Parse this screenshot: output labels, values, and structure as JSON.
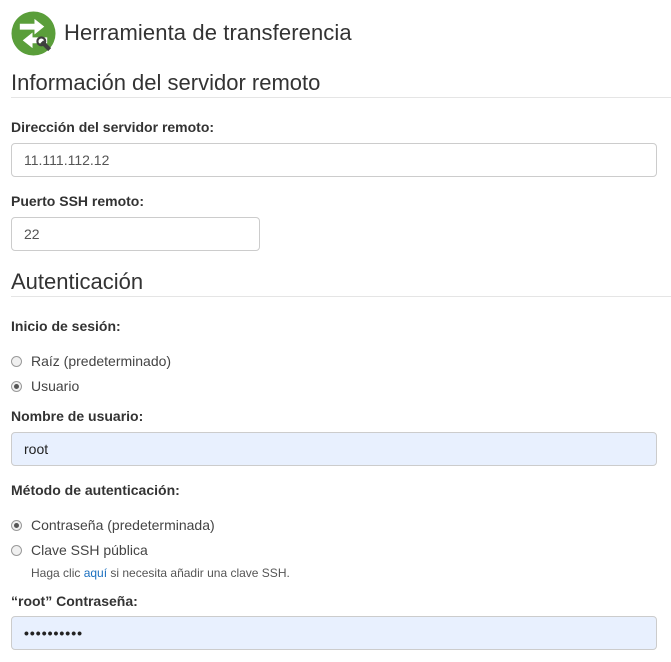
{
  "header": {
    "title": "Herramienta de transferencia",
    "logo_icon": "transfer-tool-icon",
    "logo_color": "#5a9e3a"
  },
  "remote_server": {
    "section_title": "Información del servidor remoto",
    "address_label": "Dirección del servidor remoto:",
    "address_value": "11.111.112.12",
    "port_label": "Puerto SSH remoto:",
    "port_value": "22"
  },
  "auth": {
    "section_title": "Autenticación",
    "login_label": "Inicio de sesión:",
    "login_options": [
      {
        "label": "Raíz (predeterminado)",
        "checked": false
      },
      {
        "label": "Usuario",
        "checked": true
      }
    ],
    "username_label": "Nombre de usuario:",
    "username_value": "root",
    "method_label": "Método de autenticación:",
    "method_options": [
      {
        "label": "Contraseña (predeterminada)",
        "checked": true
      },
      {
        "label": "Clave SSH pública",
        "checked": false
      }
    ],
    "help_prefix": "Haga clic ",
    "help_link": "aquí",
    "help_suffix": " si necesita añadir una clave SSH.",
    "password_label": "“root” Contraseña:",
    "password_masked": "••••••••••"
  }
}
